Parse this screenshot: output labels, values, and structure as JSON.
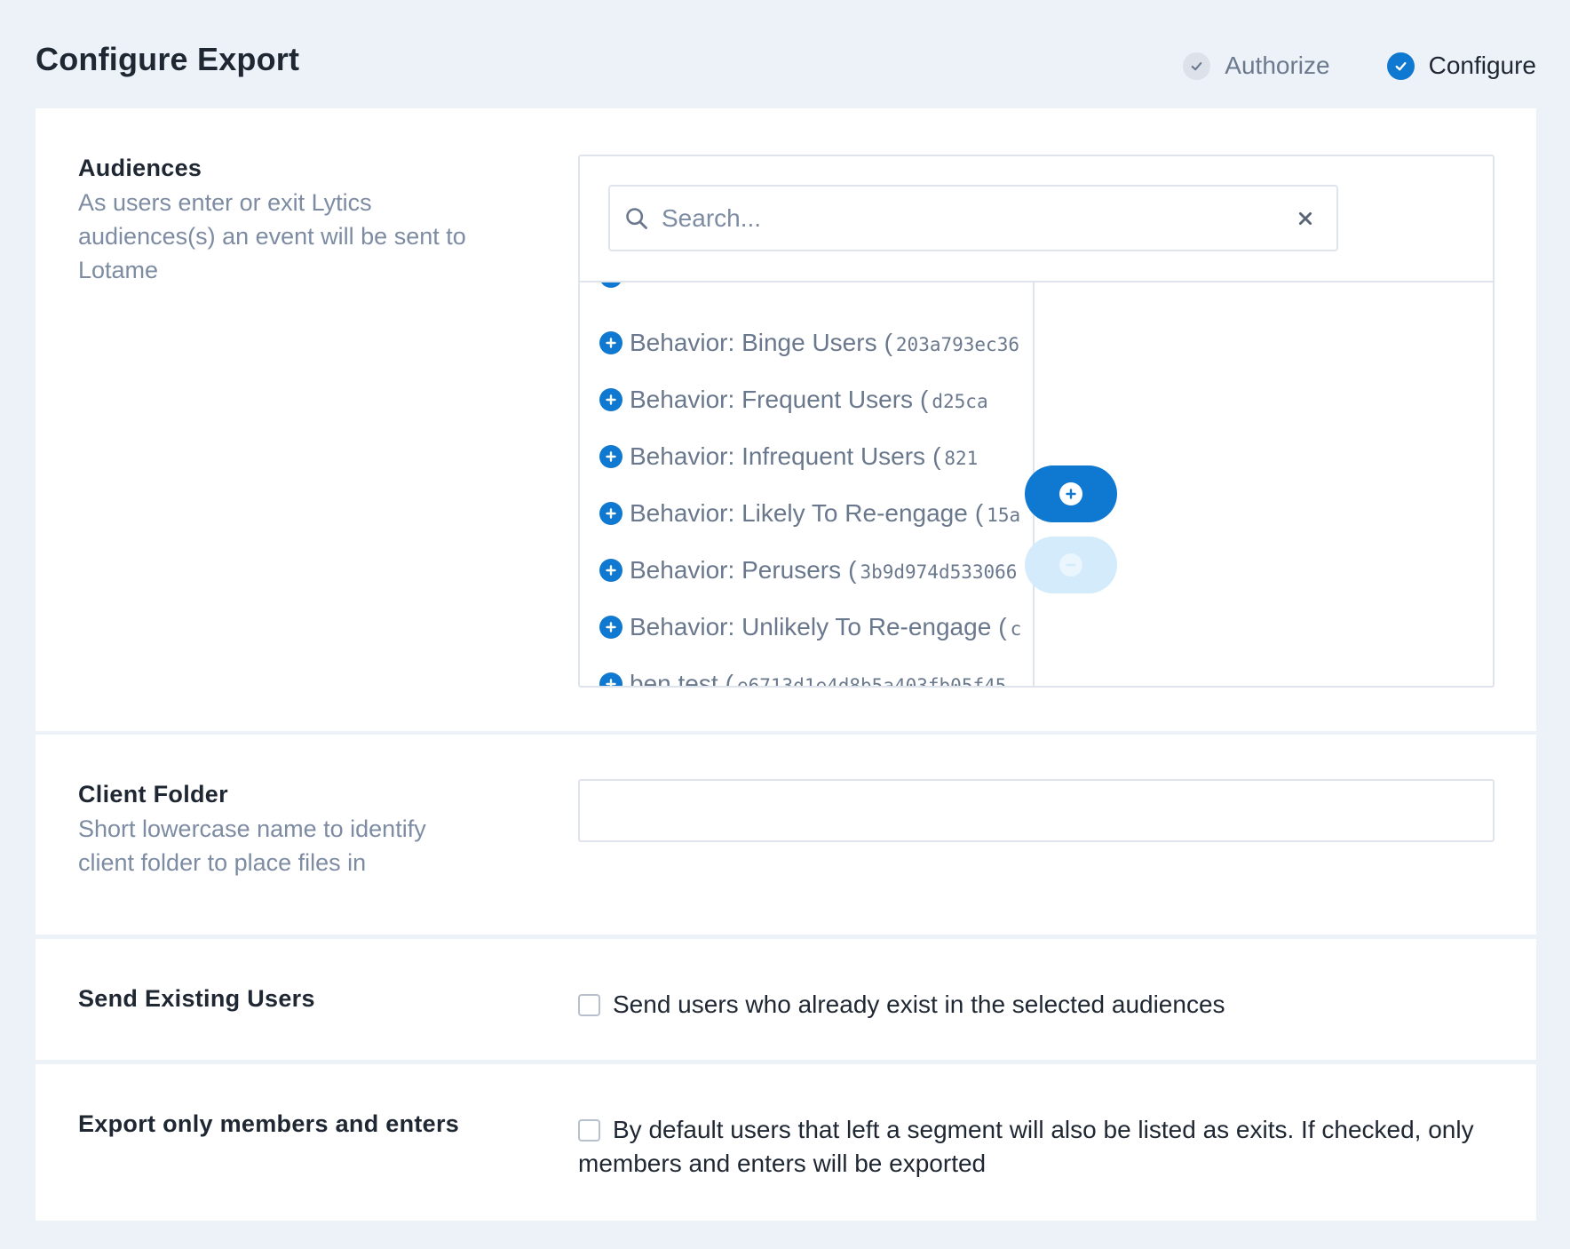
{
  "header": {
    "title": "Configure Export",
    "steps": [
      {
        "label": "Authorize",
        "state": "done"
      },
      {
        "label": "Configure",
        "state": "active"
      }
    ]
  },
  "audiences": {
    "title": "Audiences",
    "description": "As users enter or exit Lytics audiences(s) an event will be sent to Lotame",
    "search": {
      "placeholder": "Search...",
      "value": ""
    },
    "items": [
      {
        "name": "Behavior: Binge Users",
        "id": "203a793ec36"
      },
      {
        "name": "Behavior: Frequent Users",
        "id": "d25ca"
      },
      {
        "name": "Behavior: Infrequent Users",
        "id": "821"
      },
      {
        "name": "Behavior: Likely To Re-engage",
        "id": "15a"
      },
      {
        "name": "Behavior: Perusers",
        "id": "3b9d974d533066"
      },
      {
        "name": "Behavior: Unlikely To Re-engage",
        "id": "c"
      },
      {
        "name": "ben test",
        "id": "e6713d1e4d8b5a403fb05f45"
      }
    ],
    "add_icon": "plus-circle-icon",
    "remove_icon": "minus-circle-icon"
  },
  "client_folder": {
    "title": "Client Folder",
    "description": "Short lowercase name to identify client folder to place files in",
    "value": ""
  },
  "send_existing": {
    "title": "Send Existing Users",
    "checkbox_label": "Send users who already exist in the selected audiences",
    "checked": false
  },
  "export_members": {
    "title": "Export only members and enters",
    "checkbox_label": "By default users that left a segment will also be listed as exits. If checked, only members and enters will be exported",
    "checked": false
  },
  "colors": {
    "accent": "#0f78d0",
    "background": "#edf1f8",
    "muted_text": "#7d8ca3"
  }
}
